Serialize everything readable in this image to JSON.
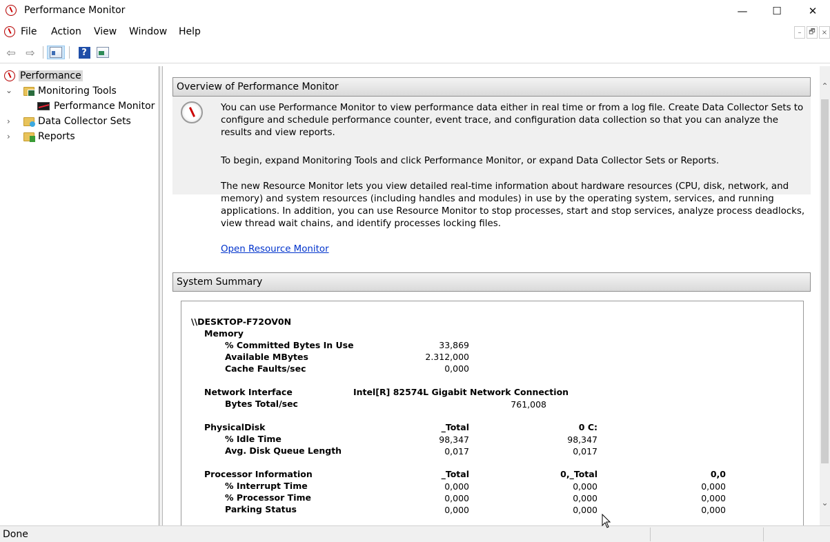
{
  "window": {
    "title": "Performance Monitor",
    "minimize_glyph": "—",
    "maximize_glyph": "☐",
    "close_glyph": "✕"
  },
  "menu": [
    "File",
    "Action",
    "View",
    "Window",
    "Help"
  ],
  "mdi": {
    "min": "–",
    "restore": "🗗",
    "close": "×"
  },
  "toolbar": {
    "help_glyph": "?",
    "back_glyph": "⇦",
    "forward_glyph": "⇨"
  },
  "tree": {
    "root": "Performance",
    "items": [
      {
        "label": "Monitoring Tools",
        "expanded": true,
        "icon": "folder-monitoring-icon"
      },
      {
        "label": "Performance Monitor",
        "icon": "performance-chart-icon"
      },
      {
        "label": "Data Collector Sets",
        "expanded": false,
        "icon": "folder-data-collector-icon"
      },
      {
        "label": "Reports",
        "expanded": false,
        "icon": "folder-reports-icon"
      }
    ]
  },
  "overview": {
    "header": "Overview of Performance Monitor",
    "p1": "You can use Performance Monitor to view performance data either in real time or from a log file. Create Data Collector Sets to configure and schedule performance counter, event trace, and configuration data collection so that you can analyze the results and view reports.",
    "p2": "To begin, expand Monitoring Tools and click Performance Monitor, or expand Data Collector Sets or Reports.",
    "p3": "The new Resource Monitor lets you view detailed real-time information about hardware resources (CPU, disk, network, and memory) and system resources (including handles and modules) in use by the operating system, services, and running applications. In addition, you can use Resource Monitor to stop processes, start and stop services, analyze process deadlocks, view thread wait chains, and identify processes locking files.",
    "link": "Open Resource Monitor"
  },
  "summary": {
    "header": "System Summary",
    "machine": "\\\\DESKTOP-F72OV0N",
    "memory": {
      "label": "Memory",
      "rows": [
        {
          "name": "% Committed Bytes In Use",
          "value": "33,869"
        },
        {
          "name": "Available MBytes",
          "value": "2.312,000"
        },
        {
          "name": "Cache Faults/sec",
          "value": "0,000"
        }
      ]
    },
    "network": {
      "label": "Network Interface",
      "instance": "Intel[R] 82574L Gigabit Network Connection",
      "rows": [
        {
          "name": "Bytes Total/sec",
          "value": "761,008"
        }
      ]
    },
    "disk": {
      "label": "PhysicalDisk",
      "columns": [
        "_Total",
        "0 C:"
      ],
      "rows": [
        {
          "name": "% Idle Time",
          "values": [
            "98,347",
            "98,347"
          ]
        },
        {
          "name": "Avg. Disk Queue Length",
          "values": [
            "0,017",
            "0,017"
          ]
        }
      ]
    },
    "processor": {
      "label": "Processor Information",
      "columns": [
        "_Total",
        "0,_Total",
        "0,0"
      ],
      "rows": [
        {
          "name": "% Interrupt Time",
          "values": [
            "0,000",
            "0,000",
            "0,000"
          ]
        },
        {
          "name": "% Processor Time",
          "values": [
            "0,000",
            "0,000",
            "0,000"
          ]
        },
        {
          "name": "Parking Status",
          "values": [
            "0,000",
            "0,000",
            "0,000"
          ]
        }
      ]
    }
  },
  "status": {
    "text": "Done"
  }
}
